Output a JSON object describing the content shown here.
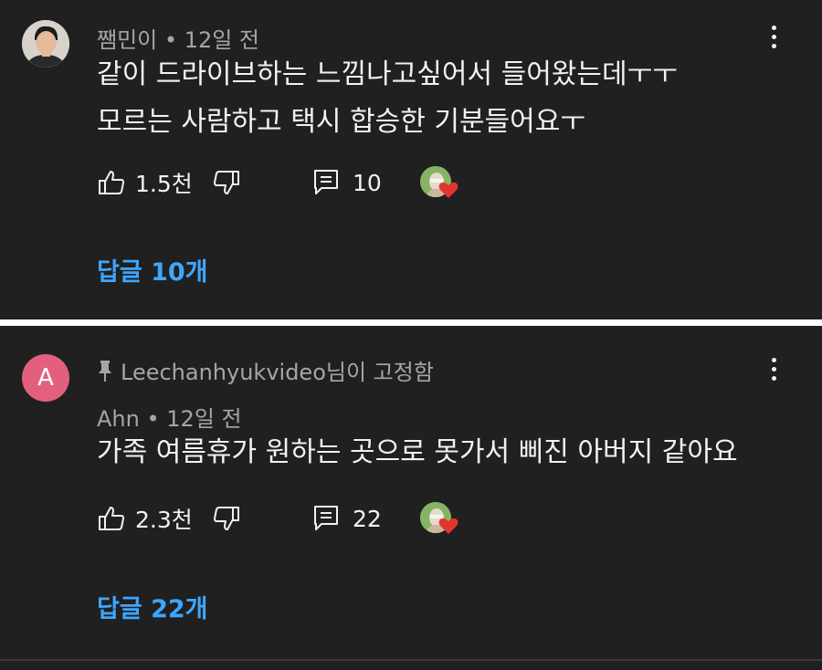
{
  "comments": [
    {
      "author": "쨈민이",
      "time": "12일 전",
      "lines": [
        "같이 드라이브하는 느낌나고싶어서 들어왔는데ㅜㅜ",
        "모르는 사람하고 택시 합승한 기분들어요ㅜ"
      ],
      "likes": "1.5천",
      "reply_count": "10",
      "replies_label": "답글 10개"
    },
    {
      "avatar_letter": "A",
      "pinned_by": "Leechanhyukvideo님이 고정함",
      "author": "Ahn",
      "time": "12일 전",
      "lines": [
        "가족 여름휴가 원하는 곳으로 못가서 삐진 아버지 같아요"
      ],
      "likes": "2.3천",
      "reply_count": "22",
      "replies_label": "답글 22개"
    }
  ],
  "icons": [
    "thumbs-up-icon",
    "thumbs-down-icon",
    "reply-icon",
    "creator-heart-icon",
    "more-vert-icon",
    "pin-icon"
  ],
  "colors": {
    "background": "#202020",
    "text": "#f2f2f2",
    "meta": "#a6a6a6",
    "link": "#3ea6ff",
    "heart": "#e5342f",
    "avatar_letter_bg": "#e2607e"
  }
}
